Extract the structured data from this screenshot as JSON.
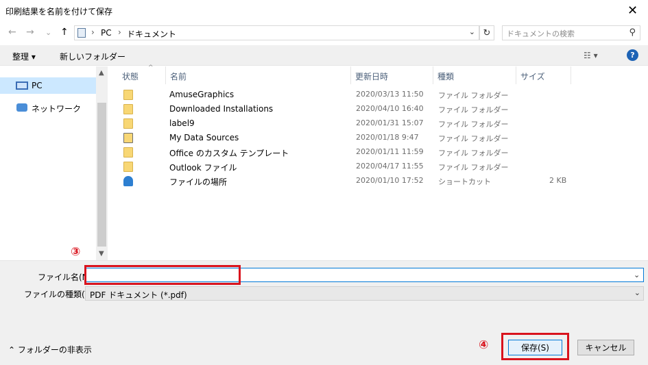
{
  "window": {
    "title": "印刷結果を名前を付けて保存",
    "close_label": "✕"
  },
  "nav": {
    "back": "←",
    "forward": "→",
    "recent": "⌄",
    "up": "↑",
    "breadcrumb": [
      "PC",
      "ドキュメント"
    ],
    "refresh": "↻",
    "search_placeholder": "ドキュメントの検索",
    "search_icon": "⚲"
  },
  "toolbar": {
    "organize_label": "整理 ▾",
    "new_folder_label": "新しいフォルダー",
    "view_icon_label": "☷ ▾",
    "help_label": "?"
  },
  "sidebar": {
    "items": [
      {
        "label": "PC",
        "icon": "pc-icon",
        "selected": true
      },
      {
        "label": "ネットワーク",
        "icon": "network-icon",
        "selected": false
      }
    ],
    "scroll_up": "▲",
    "scroll_down": "▼"
  },
  "columns": {
    "status": "状態",
    "name": "名前",
    "modified": "更新日時",
    "type": "種類",
    "size": "サイズ",
    "sort_caret": "^"
  },
  "files": [
    {
      "icon": "folder",
      "name": "AmuseGraphics",
      "modified": "2020/03/13 11:50",
      "type": "ファイル フォルダー",
      "size": ""
    },
    {
      "icon": "folder",
      "name": "Downloaded Installations",
      "modified": "2020/04/10 16:40",
      "type": "ファイル フォルダー",
      "size": ""
    },
    {
      "icon": "folder",
      "name": "label9",
      "modified": "2020/01/31 15:07",
      "type": "ファイル フォルダー",
      "size": ""
    },
    {
      "icon": "special-folder",
      "name": "My Data Sources",
      "modified": "2020/01/18 9:47",
      "type": "ファイル フォルダー",
      "size": ""
    },
    {
      "icon": "folder",
      "name": "Office のカスタム テンプレート",
      "modified": "2020/01/11 11:59",
      "type": "ファイル フォルダー",
      "size": ""
    },
    {
      "icon": "folder",
      "name": "Outlook ファイル",
      "modified": "2020/04/17 11:55",
      "type": "ファイル フォルダー",
      "size": ""
    },
    {
      "icon": "shortcut",
      "name": "ファイルの場所",
      "modified": "2020/01/10 17:52",
      "type": "ショートカット",
      "size": "2 KB"
    }
  ],
  "form": {
    "filename_label": "ファイル名(N):",
    "filename_value": "",
    "filetype_label": "ファイルの種類(T):",
    "filetype_value": "PDF ドキュメント (*.pdf)",
    "dropdown_caret": "⌄"
  },
  "footer": {
    "hide_folders_label": "⌃  フォルダーの非表示",
    "save_label": "保存(S)",
    "cancel_label": "キャンセル"
  },
  "annotations": {
    "step3": "③",
    "step4": "④",
    "color": "#d9131d"
  }
}
